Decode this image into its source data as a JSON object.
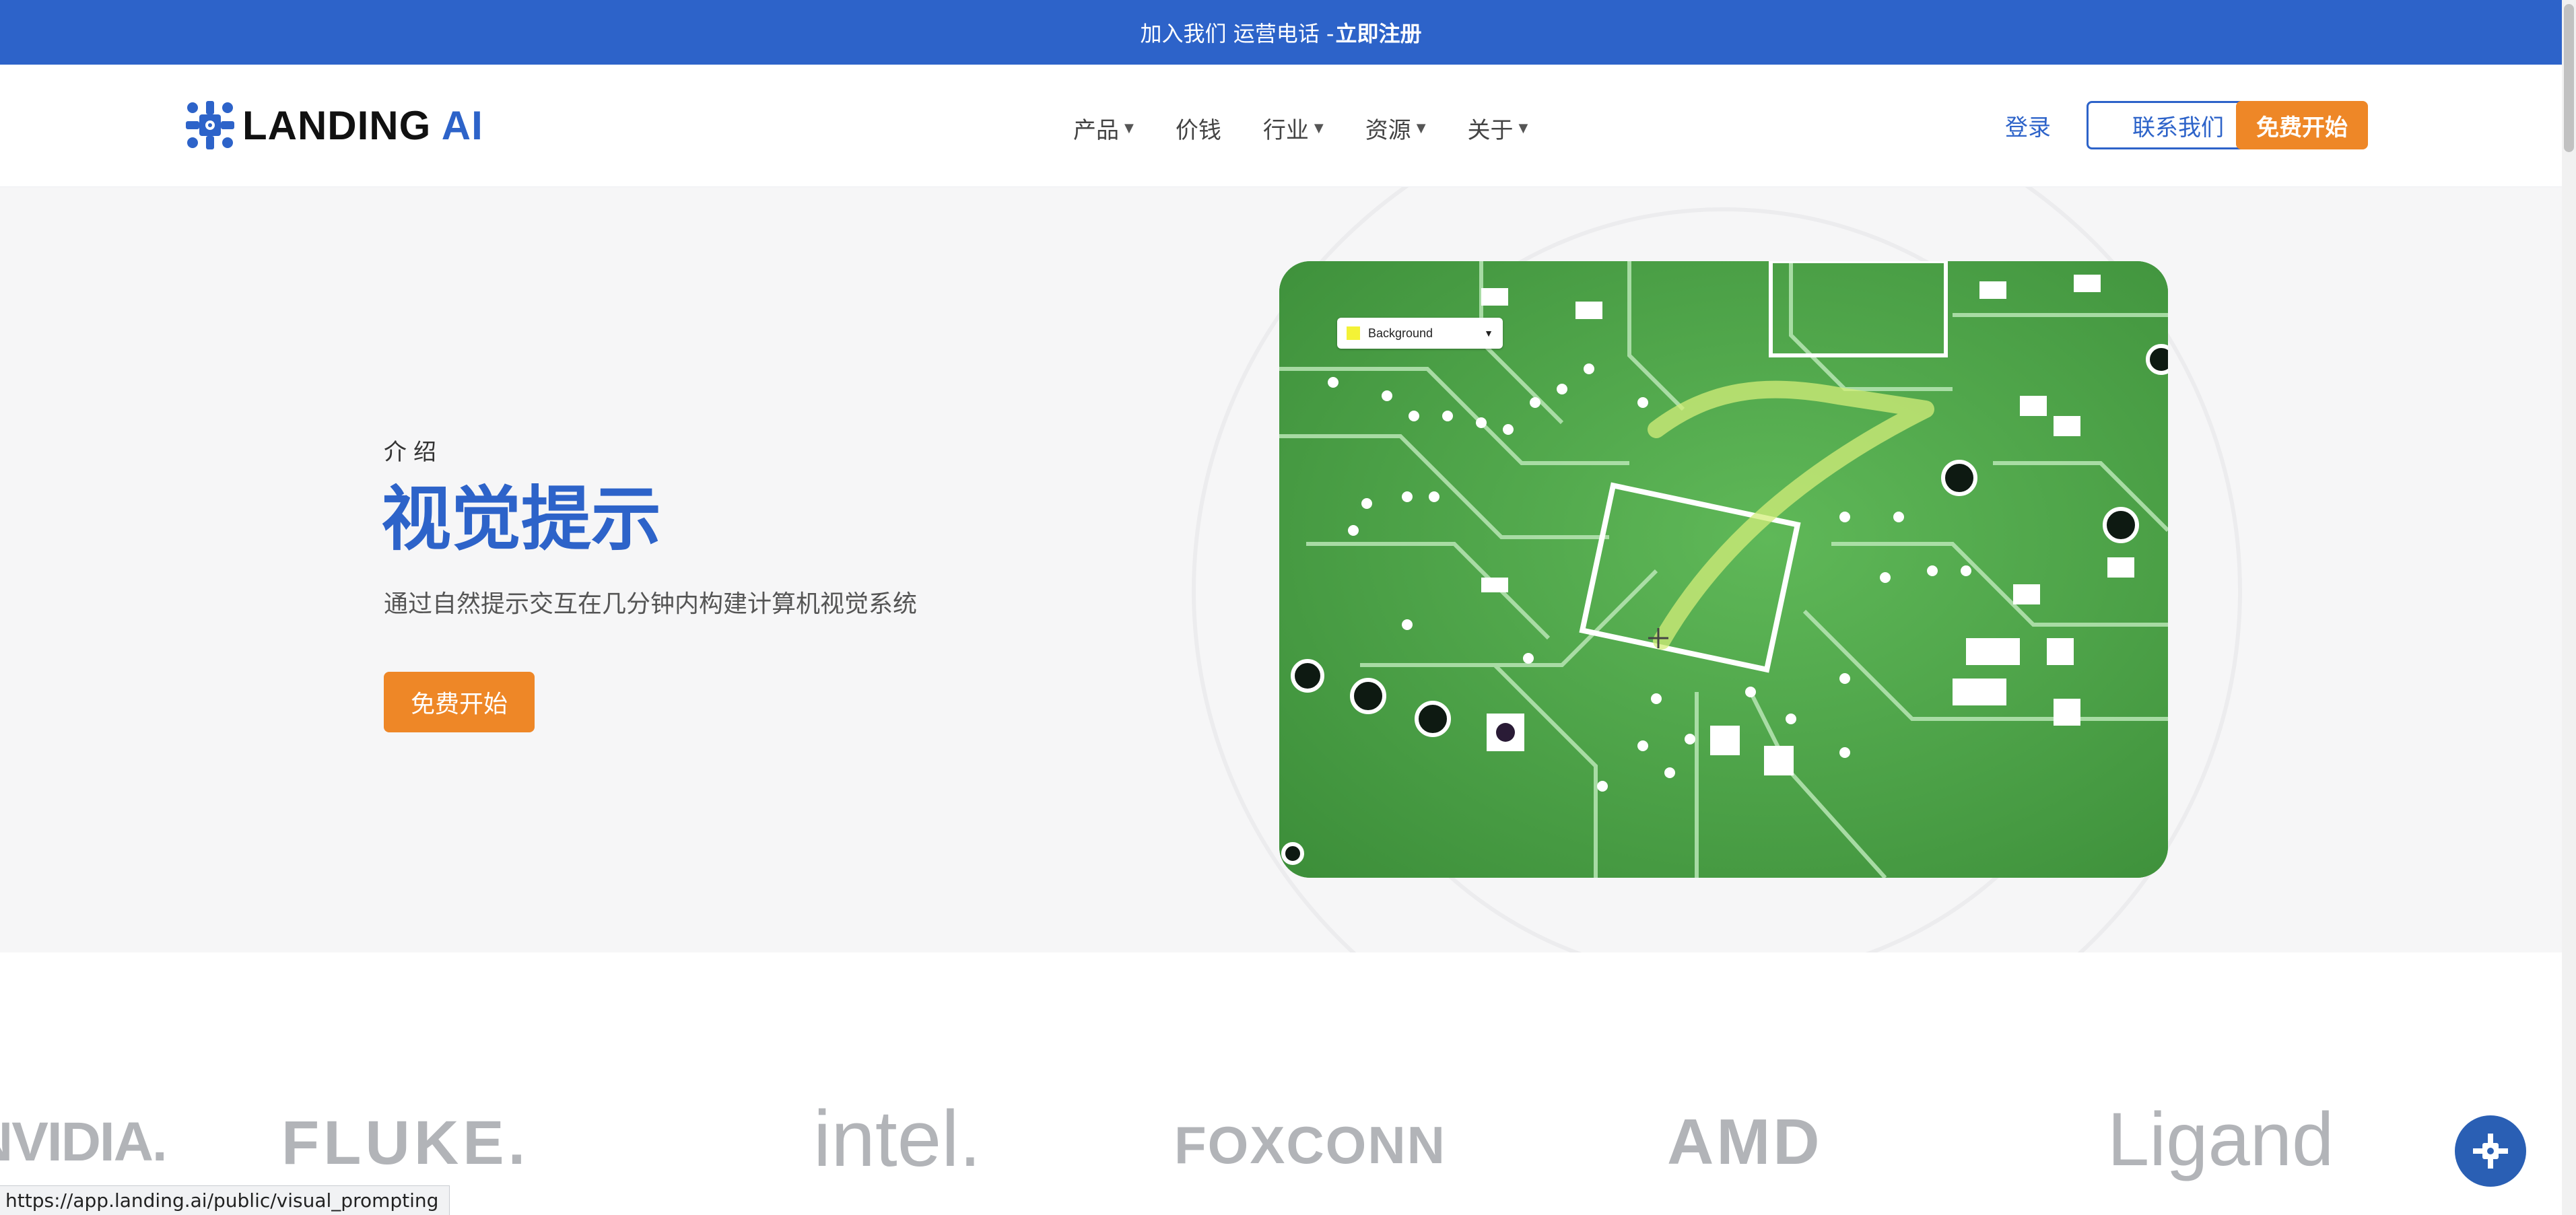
{
  "topbar": {
    "text": "加入我们 运营电话 -",
    "cta": "立即注册"
  },
  "nav": {
    "logo_main": "LANDING",
    "logo_accent": "AI",
    "menu": [
      {
        "label": "产品",
        "has_dropdown": true
      },
      {
        "label": "价钱",
        "has_dropdown": false
      },
      {
        "label": "行业",
        "has_dropdown": true
      },
      {
        "label": "资源",
        "has_dropdown": true
      },
      {
        "label": "关于",
        "has_dropdown": true
      }
    ],
    "login": "登录",
    "contact": "联系我们",
    "free_start": "免费开始"
  },
  "hero": {
    "intro": "介绍",
    "title": "视觉提示",
    "subtitle": "通过自然提示交互在几分钟内构建计算机视觉系统",
    "cta": "免费开始",
    "image": {
      "dropdown_label": "Background",
      "swatch_color": "#f4f236"
    }
  },
  "logos": [
    "NVIDIA.",
    "FLUKE.",
    "intel.",
    "FOXCONN",
    "AMD",
    "Ligand"
  ],
  "status_bar": {
    "url": "https://app.landing.ai/public/visual_prompting"
  },
  "colors": {
    "brand_blue": "#2d63c9",
    "accent_orange": "#ee8727",
    "logo_gray": "#b2b4b8"
  }
}
